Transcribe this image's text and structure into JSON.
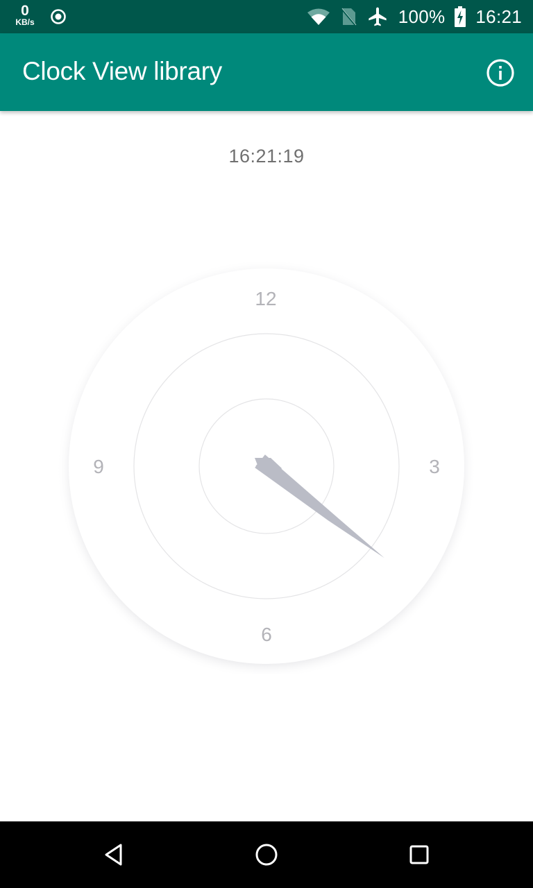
{
  "status_bar": {
    "net_speed_value": "0",
    "net_speed_unit": "KB/s",
    "sync_icon": "sync-target-icon",
    "wifi_icon": "wifi-icon",
    "sim_icon": "no-sim-icon",
    "airplane_icon": "airplane-mode-icon",
    "battery_percent": "100%",
    "battery_icon": "battery-charging-icon",
    "time": "16:21",
    "background_color": "#00574b"
  },
  "app_bar": {
    "title": "Clock View library",
    "info_icon": "info-icon",
    "background_color": "#00897b"
  },
  "main": {
    "digital_time": "16:21:19",
    "clock": {
      "hour_labels": [
        "12",
        "3",
        "6",
        "9"
      ],
      "time": {
        "hours": 16,
        "minutes": 21,
        "seconds": 19
      },
      "hand_color": "#babcc6",
      "label_color": "#b3b3b8",
      "ring_color": "#e4e4e6"
    }
  },
  "nav_bar": {
    "back_icon": "back-triangle-icon",
    "home_icon": "home-circle-icon",
    "recents_icon": "recents-square-icon"
  }
}
